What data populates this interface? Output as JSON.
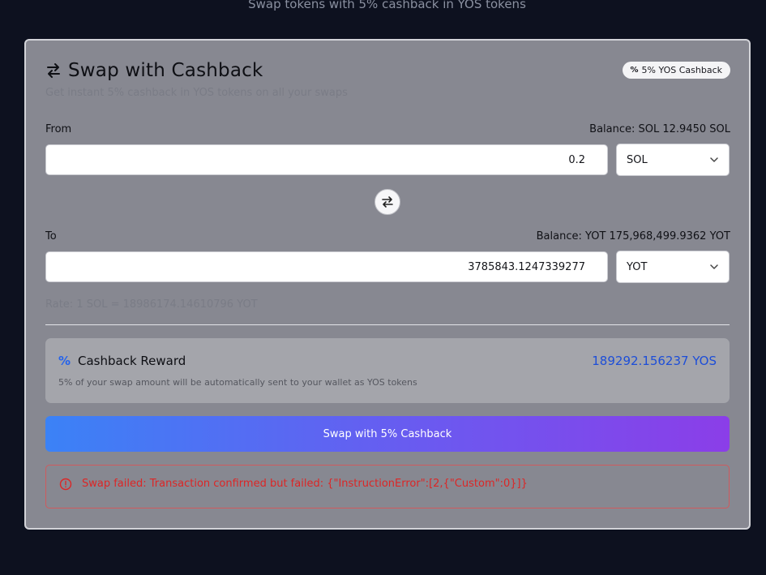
{
  "page": {
    "subtitle": "Swap tokens with 5% cashback in YOS tokens"
  },
  "card": {
    "title": "Swap with Cashback",
    "subtitle": "Get instant 5% cashback in YOS tokens on all your swaps",
    "badge": {
      "icon": "percent-icon",
      "icon_glyph": "%",
      "label": "5% YOS Cashback"
    }
  },
  "from": {
    "label": "From",
    "balance": "Balance: SOL 12.9450 SOL",
    "amount": "0.2",
    "token": "SOL"
  },
  "swap_direction": {
    "icon": "arrows-swap-icon"
  },
  "to": {
    "label": "To",
    "balance": "Balance: YOT 175,968,499.9362 YOT",
    "amount": "3785843.1247339277",
    "token": "YOT"
  },
  "rate": "Rate: 1 SOL = 18986174.14610796 YOT",
  "reward": {
    "icon_glyph": "%",
    "title": "Cashback Reward",
    "amount": "189292.156237 YOS",
    "description": "5% of your swap amount will be automatically sent to your wallet as YOS tokens"
  },
  "swap_button": {
    "label": "Swap with 5% Cashback"
  },
  "error": {
    "message": "Swap failed: Transaction confirmed but failed: {\"InstructionError\":[2,{\"Custom\":0}]}"
  },
  "colors": {
    "background": "#0d111f",
    "card": "#878891",
    "accent_blue": "#3b82f6",
    "accent_purple": "#8b3ee8",
    "reward_amount": "#1d4ed8",
    "error": "#dc2626"
  }
}
